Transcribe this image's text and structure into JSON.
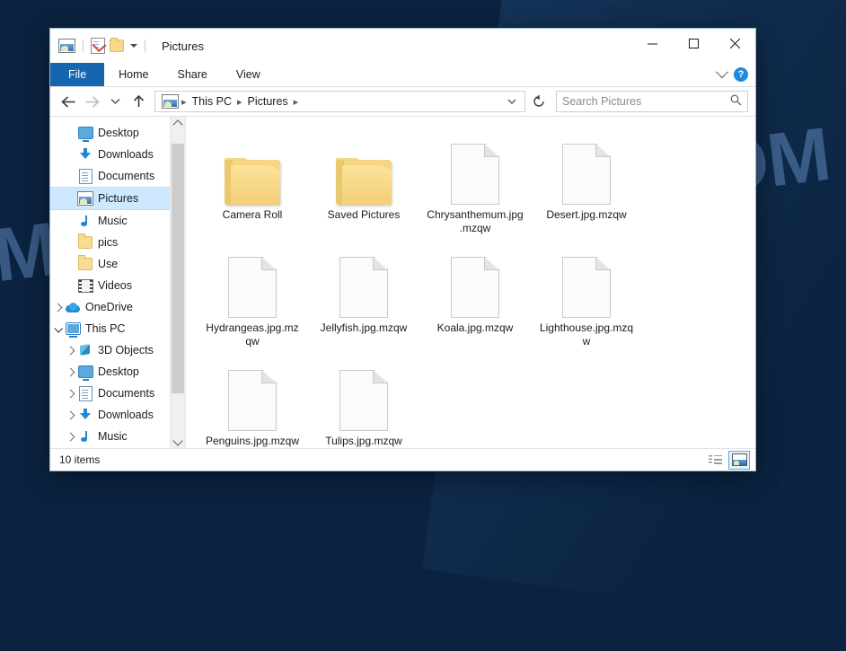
{
  "desktop": {
    "watermark": "MYANTISPYWARE.COM",
    "background_color": "#0b2340"
  },
  "window": {
    "title": "Pictures",
    "accent_color": "#1565b0",
    "quick_access": [
      {
        "name": "pictures-icon",
        "label": "Pictures"
      },
      {
        "name": "properties-icon",
        "label": "Properties"
      },
      {
        "name": "new-folder-icon",
        "label": "New folder"
      },
      {
        "name": "customize-caret",
        "label": "Customize Quick Access Toolbar"
      }
    ],
    "controls": {
      "minimize": "Minimize",
      "maximize": "Maximize",
      "close": "Close"
    }
  },
  "ribbon": {
    "tabs": [
      {
        "label": "File",
        "active": true
      },
      {
        "label": "Home",
        "active": false
      },
      {
        "label": "Share",
        "active": false
      },
      {
        "label": "View",
        "active": false
      }
    ],
    "expand_label": "Expand the Ribbon",
    "help_label": "?"
  },
  "address": {
    "back_label": "Back",
    "forward_label": "Forward",
    "recent_label": "Recent locations",
    "up_label": "Up",
    "breadcrumbs": [
      "This PC",
      "Pictures"
    ],
    "refresh_label": "Refresh"
  },
  "search": {
    "placeholder": "Search Pictures",
    "value": "",
    "icon": "search-icon"
  },
  "navpane": {
    "items": [
      {
        "label": "Desktop",
        "icon": "desktop-icon",
        "indent": 1,
        "expander": "none",
        "pinned": true,
        "selected": false
      },
      {
        "label": "Downloads",
        "icon": "download-icon",
        "indent": 1,
        "expander": "none",
        "pinned": true,
        "selected": false
      },
      {
        "label": "Documents",
        "icon": "document-icon",
        "indent": 1,
        "expander": "none",
        "pinned": true,
        "selected": false
      },
      {
        "label": "Pictures",
        "icon": "pictures-icon",
        "indent": 1,
        "expander": "none",
        "pinned": true,
        "selected": true
      },
      {
        "label": "Music",
        "icon": "music-icon",
        "indent": 1,
        "expander": "none",
        "pinned": false,
        "selected": false
      },
      {
        "label": "pics",
        "icon": "folder-icon",
        "indent": 1,
        "expander": "none",
        "pinned": false,
        "selected": false
      },
      {
        "label": "Use",
        "icon": "folder-icon",
        "indent": 1,
        "expander": "none",
        "pinned": false,
        "selected": false
      },
      {
        "label": "Videos",
        "icon": "video-icon",
        "indent": 1,
        "expander": "none",
        "pinned": false,
        "selected": false
      },
      {
        "label": "OneDrive",
        "icon": "cloud-icon",
        "indent": 0,
        "expander": "collapsed",
        "pinned": false,
        "selected": false
      },
      {
        "label": "This PC",
        "icon": "pc-icon",
        "indent": 0,
        "expander": "expanded",
        "pinned": false,
        "selected": false
      },
      {
        "label": "3D Objects",
        "icon": "cube-icon",
        "indent": 1,
        "expander": "collapsed",
        "pinned": false,
        "selected": false
      },
      {
        "label": "Desktop",
        "icon": "desktop-icon",
        "indent": 1,
        "expander": "collapsed",
        "pinned": false,
        "selected": false
      },
      {
        "label": "Documents",
        "icon": "document-icon",
        "indent": 1,
        "expander": "collapsed",
        "pinned": false,
        "selected": false
      },
      {
        "label": "Downloads",
        "icon": "download-icon",
        "indent": 1,
        "expander": "collapsed",
        "pinned": false,
        "selected": false
      },
      {
        "label": "Music",
        "icon": "music-icon",
        "indent": 1,
        "expander": "collapsed",
        "pinned": false,
        "selected": false
      }
    ],
    "scrollbar": {
      "up": "Scroll up",
      "down": "Scroll down"
    }
  },
  "files": [
    {
      "name": "Camera Roll",
      "type": "folder"
    },
    {
      "name": "Saved Pictures",
      "type": "folder"
    },
    {
      "name": "Chrysanthemum.jpg.mzqw",
      "type": "file"
    },
    {
      "name": "Desert.jpg.mzqw",
      "type": "file"
    },
    {
      "name": "Hydrangeas.jpg.mzqw",
      "type": "file"
    },
    {
      "name": "Jellyfish.jpg.mzqw",
      "type": "file"
    },
    {
      "name": "Koala.jpg.mzqw",
      "type": "file"
    },
    {
      "name": "Lighthouse.jpg.mzqw",
      "type": "file"
    },
    {
      "name": "Penguins.jpg.mzqw",
      "type": "file"
    },
    {
      "name": "Tulips.jpg.mzqw",
      "type": "file"
    }
  ],
  "statusbar": {
    "item_count": "10 items",
    "views": [
      {
        "name": "details-view",
        "label": "Details view",
        "active": false
      },
      {
        "name": "large-icons-view",
        "label": "Large icons view",
        "active": true
      }
    ]
  }
}
